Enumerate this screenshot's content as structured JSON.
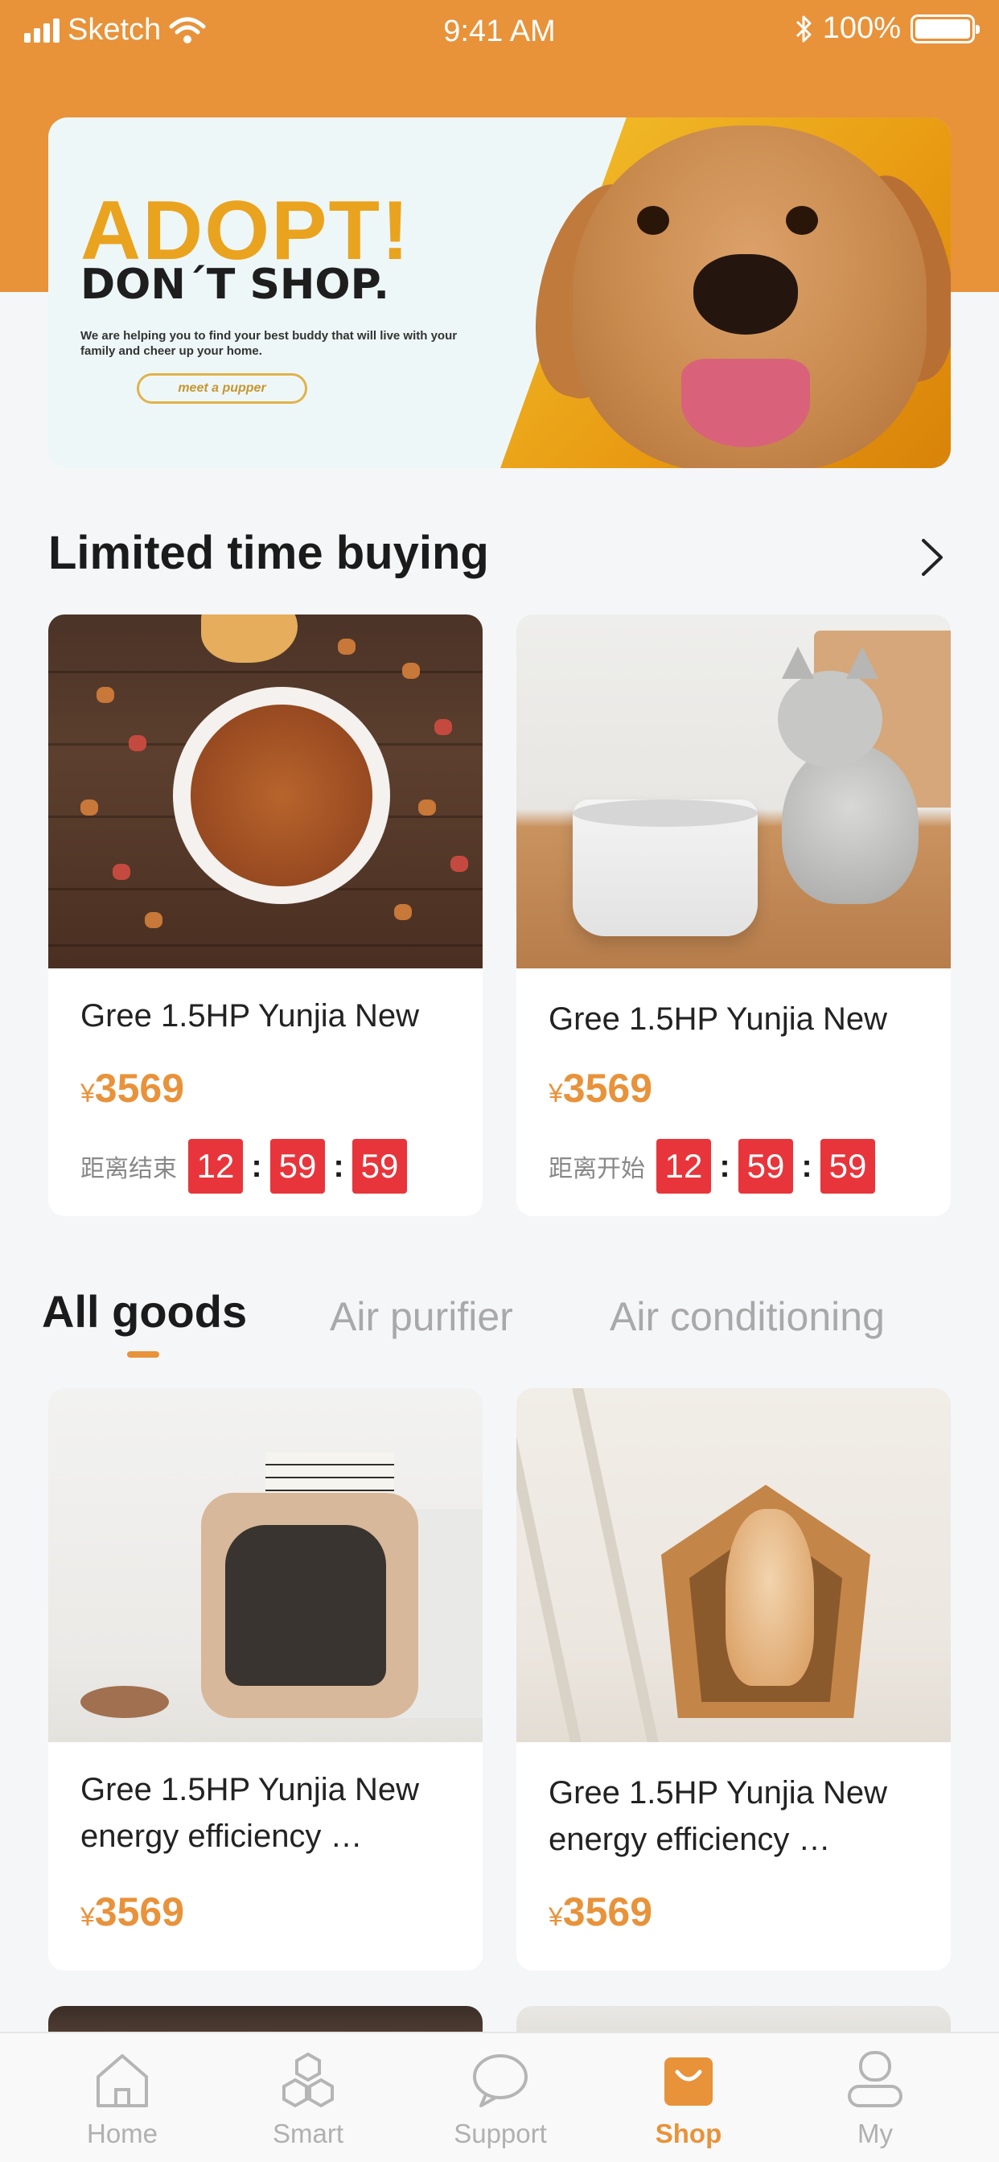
{
  "status_bar": {
    "carrier": "Sketch",
    "time": "9:41 AM",
    "battery": "100%"
  },
  "banner": {
    "title": "ADOPT!",
    "subtitle": "DON´T SHOP.",
    "text": "We are helping you to find your best buddy that will live with your family and cheer up your home.",
    "button_label": "meet a pupper"
  },
  "limited": {
    "title": "Limited time buying",
    "items": [
      {
        "name": "Gree 1.5HP Yunjia New",
        "currency": "¥",
        "price": "3569",
        "countdown_label": "距离结束",
        "hours": "12",
        "minutes": "59",
        "seconds": "59",
        "image": "dog-food-bowl"
      },
      {
        "name": "Gree 1.5HP Yunjia New",
        "currency": "¥",
        "price": "3569",
        "countdown_label": "距离开始",
        "hours": "12",
        "minutes": "59",
        "seconds": "59",
        "image": "cat-water-fountain"
      }
    ]
  },
  "tabs": [
    {
      "label": "All goods",
      "active": true
    },
    {
      "label": "Air purifier",
      "active": false
    },
    {
      "label": "Air conditioning",
      "active": false
    }
  ],
  "goods": [
    {
      "line1": "Gree 1.5HP Yunjia New",
      "line2": "energy efficiency …",
      "currency": "¥",
      "price": "3569",
      "image": "pet-house-white"
    },
    {
      "line1": "Gree 1.5HP Yunjia New",
      "line2": "energy efficiency …",
      "currency": "¥",
      "price": "3569",
      "image": "wooden-pet-house"
    }
  ],
  "nav": [
    {
      "label": "Home",
      "icon": "home-icon",
      "active": false
    },
    {
      "label": "Smart",
      "icon": "cubes-icon",
      "active": false
    },
    {
      "label": "Support",
      "icon": "chat-icon",
      "active": false
    },
    {
      "label": "Shop",
      "icon": "shopping-bag-icon",
      "active": true
    },
    {
      "label": "My",
      "icon": "user-icon",
      "active": false
    }
  ],
  "colors": {
    "accent": "#e8923a",
    "countdown": "#e7353b",
    "background": "#f5f6f8"
  }
}
